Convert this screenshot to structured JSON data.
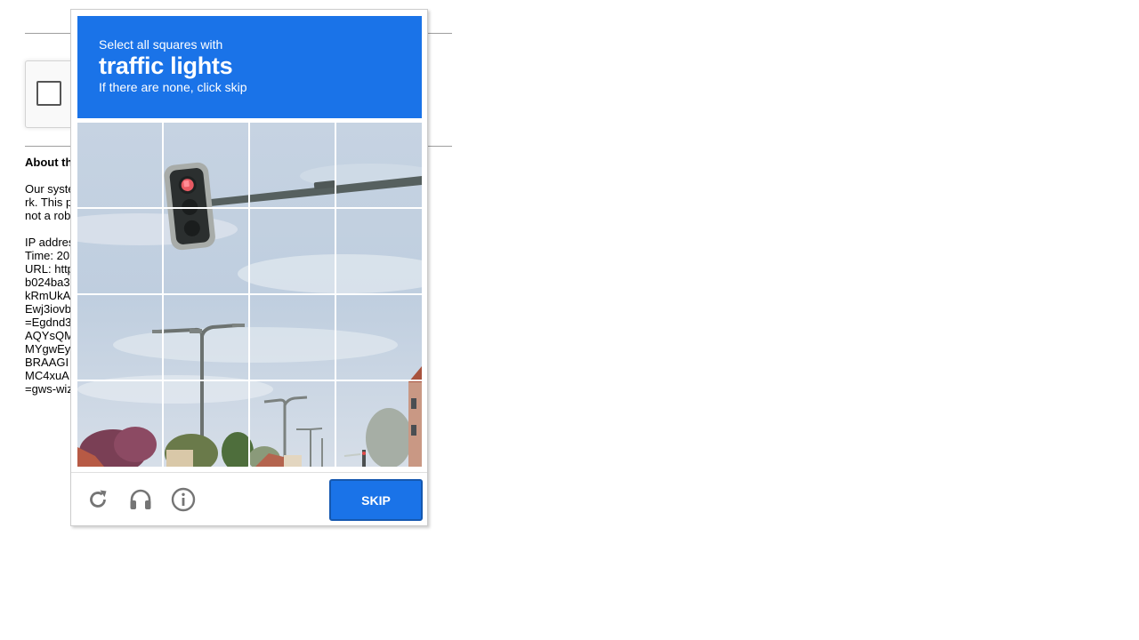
{
  "background_page": {
    "about_heading": "About th",
    "paragraph1": [
      "Our syste",
      "rk. This p",
      "not a rob"
    ],
    "paragraph2": [
      "IP addres",
      "Time: 20",
      "URL: http",
      "b024ba3",
      "kRmUkA",
      "Ewj3iovb",
      "=Egdnd3",
      "AQYsQM",
      "MYgwEy",
      "BRAAGI",
      "MC4xuA",
      "=gws-wiz"
    ]
  },
  "challenge": {
    "instruction": "Select all squares with",
    "target": "traffic lights",
    "hint": "If there are none, click skip",
    "grid": {
      "rows": 4,
      "cols": 4
    },
    "footer": {
      "reload_icon": "reload-icon",
      "audio_icon": "headphones-icon",
      "info_icon": "info-icon",
      "skip_label": "SKIP"
    },
    "colors": {
      "header_bg": "#1a73e8",
      "button_bg": "#1a73e8",
      "button_border": "#1558b0",
      "icon_gray": "#757575"
    }
  }
}
